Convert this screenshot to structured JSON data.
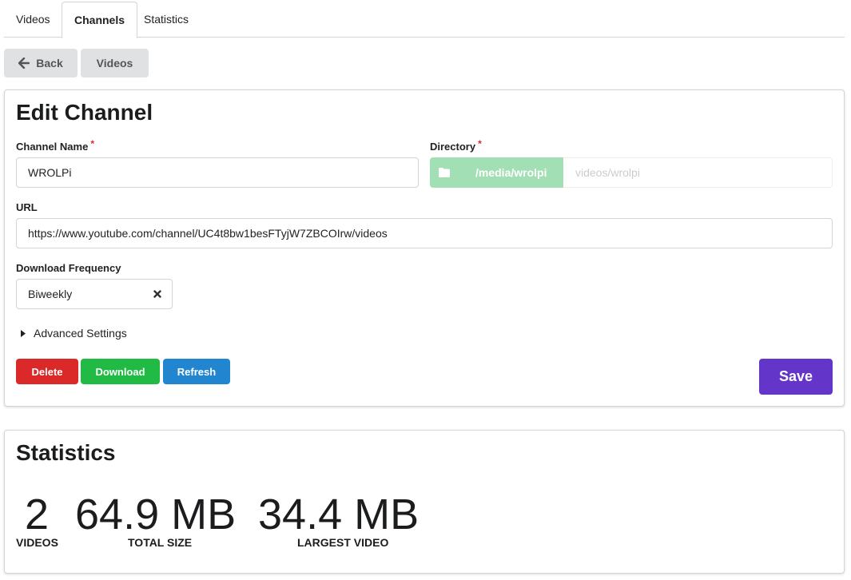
{
  "tabs": [
    {
      "label": "Videos"
    },
    {
      "label": "Channels"
    },
    {
      "label": "Statistics"
    }
  ],
  "top_buttons": {
    "back_label": "Back",
    "videos_label": "Videos"
  },
  "edit_channel": {
    "title": "Edit Channel",
    "channel_name_label": "Channel Name",
    "channel_name_value": "WROLPi",
    "directory_label": "Directory",
    "directory_prefix": "/media/wrolpi",
    "directory_placeholder": "videos/wrolpi",
    "url_label": "URL",
    "url_value": "https://www.youtube.com/channel/UC4t8bw1besFTyjW7ZBCOIrw/videos",
    "frequency_label": "Download Frequency",
    "frequency_value": "Biweekly",
    "advanced_label": "Advanced Settings",
    "required_mark": "*",
    "delete_label": "Delete",
    "download_label": "Download",
    "refresh_label": "Refresh",
    "save_label": "Save"
  },
  "statistics": {
    "title": "Statistics",
    "items": [
      {
        "value": "2",
        "label": "Videos"
      },
      {
        "value": "64.9 MB",
        "label": "Total Size"
      },
      {
        "value": "34.4 MB",
        "label": "Largest Video"
      }
    ]
  },
  "colors": {
    "delete": "#db2828",
    "download": "#21ba45",
    "refresh": "#2185d0",
    "save": "#6435c9",
    "directory": "#a3dfb4"
  },
  "icons": {
    "back": "arrow-left-icon",
    "folder": "folder-icon",
    "clear": "x-icon",
    "caret": "caret-right-icon"
  }
}
